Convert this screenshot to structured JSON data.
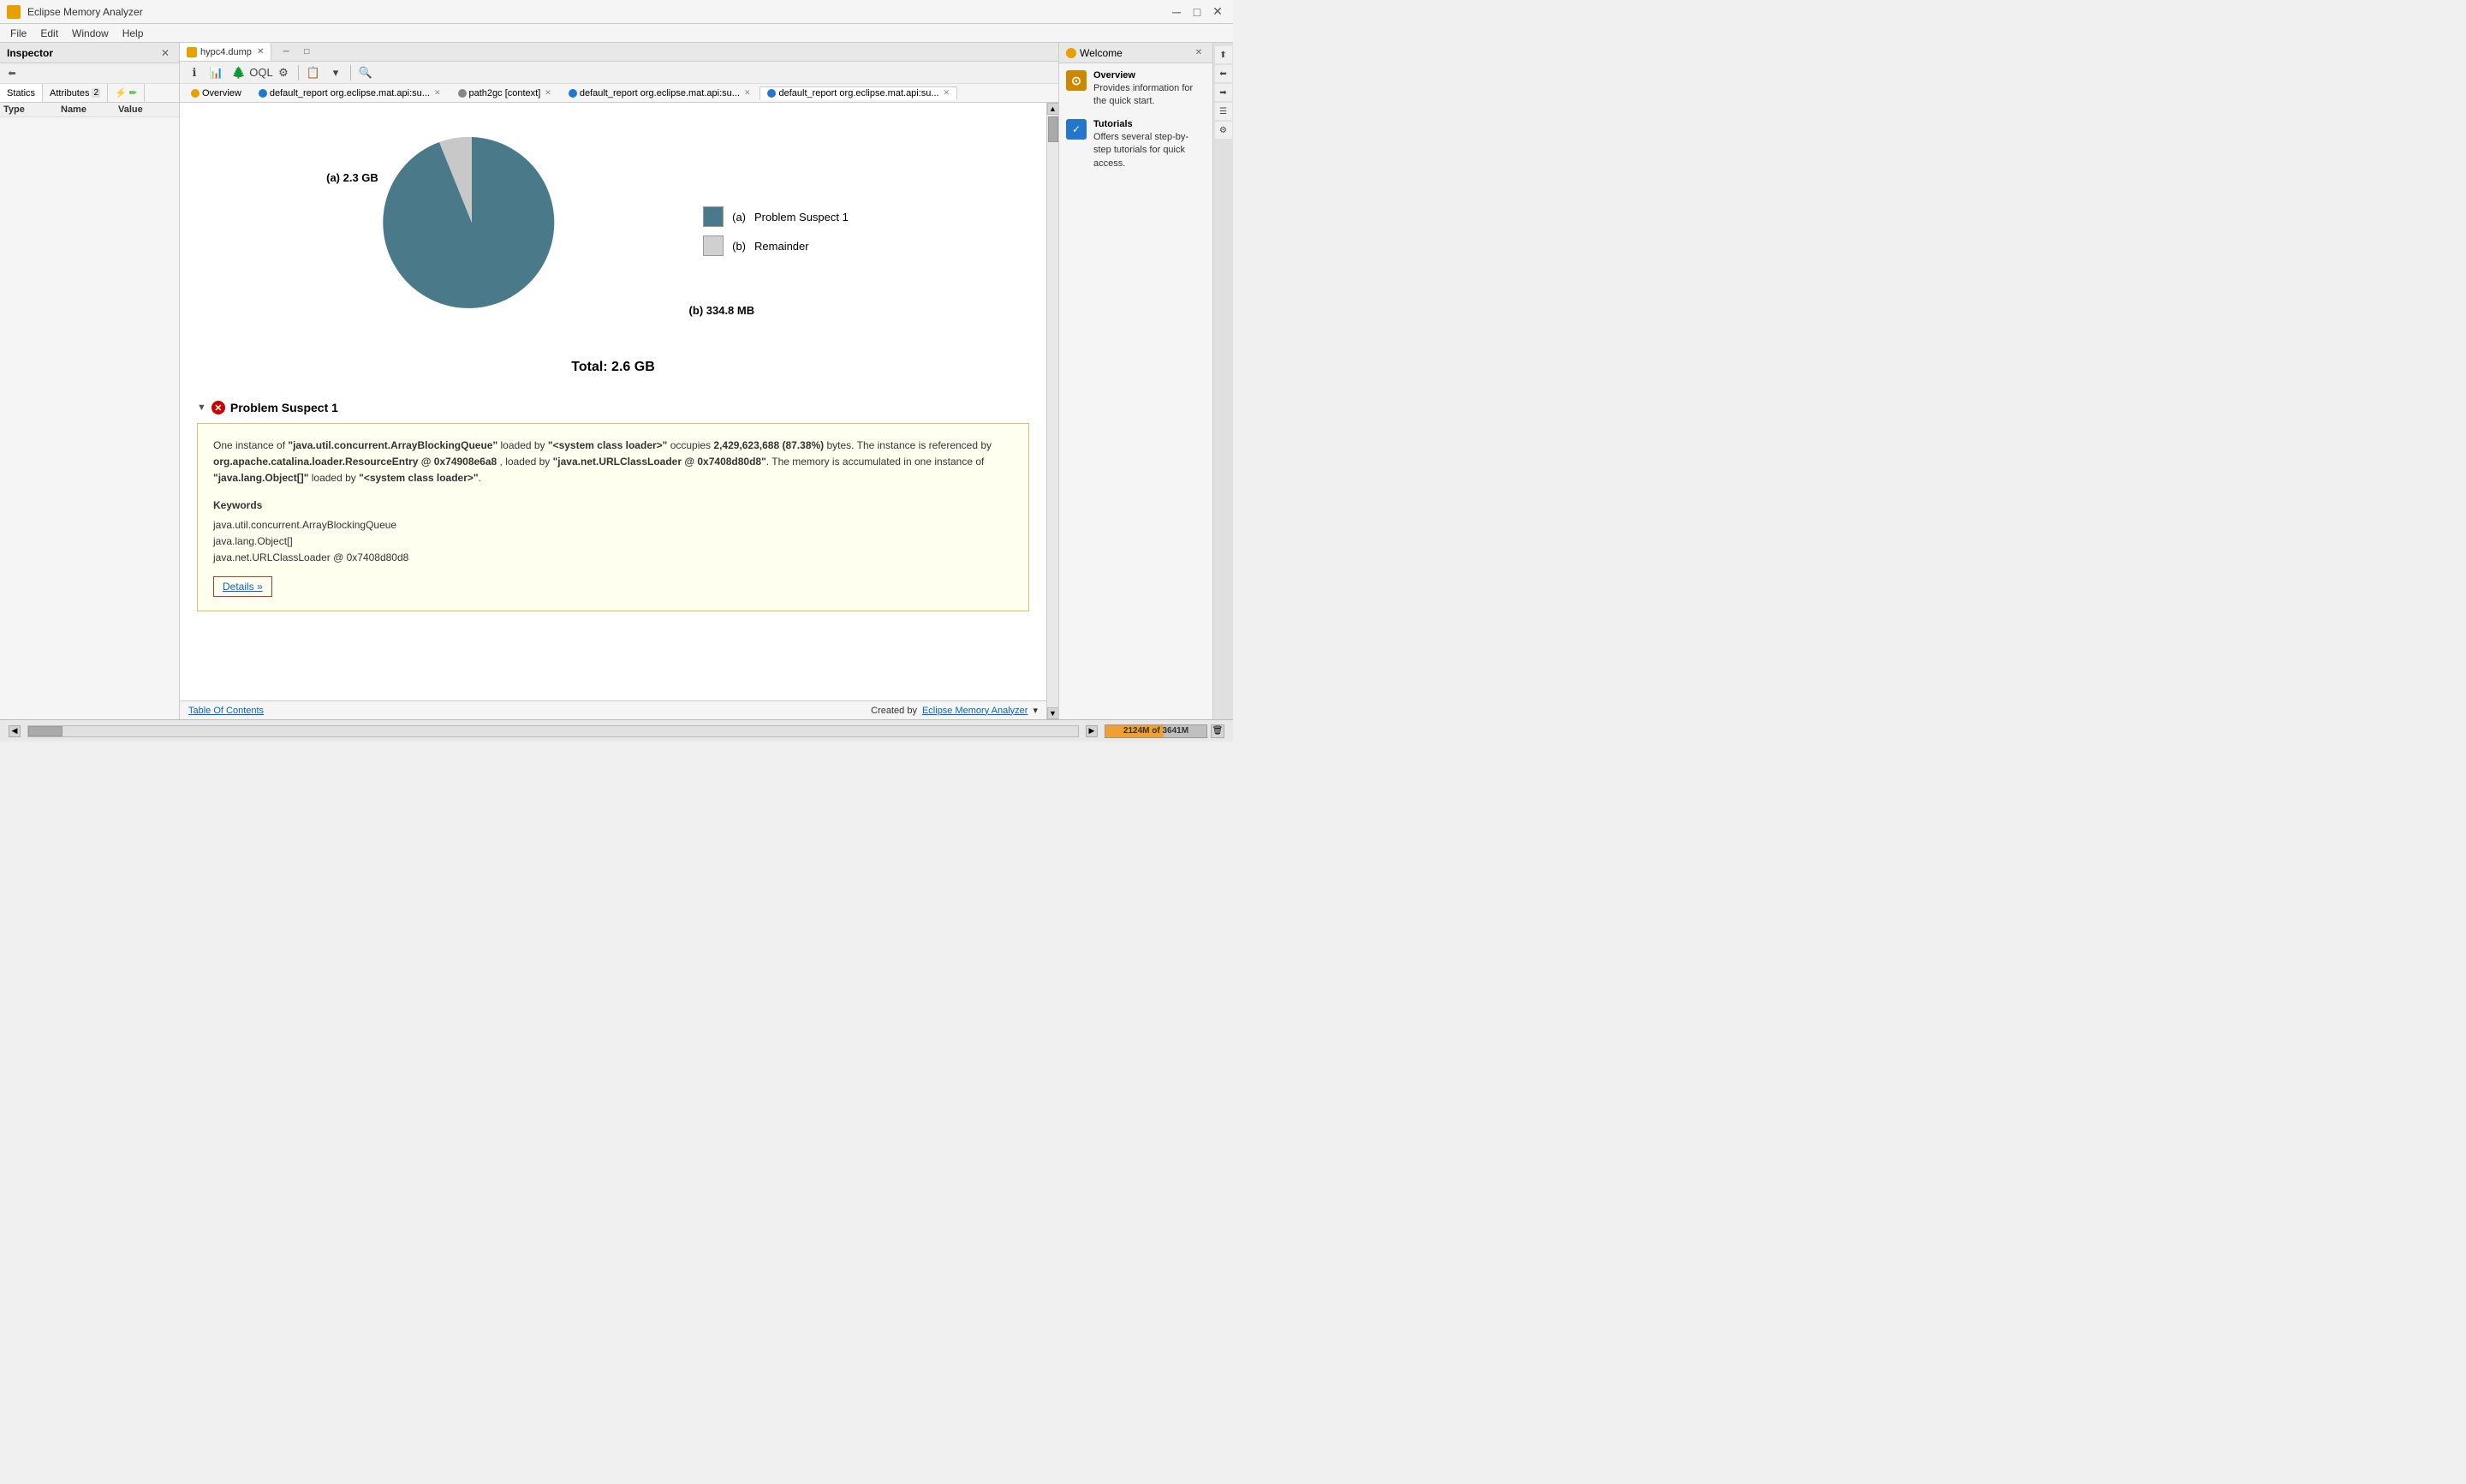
{
  "title_bar": {
    "title": "Eclipse Memory Analyzer",
    "icon": "⚙"
  },
  "menu": {
    "items": [
      "File",
      "Edit",
      "Window",
      "Help"
    ]
  },
  "left_panel": {
    "title": "Inspector",
    "close_label": "×",
    "subtabs": [
      {
        "label": "Statics",
        "active": true
      },
      {
        "label": "Attributes",
        "active": false,
        "badge": "2"
      },
      {
        "label": "⚡",
        "active": false
      }
    ],
    "columns": [
      "Type",
      "Name",
      "Value"
    ]
  },
  "tabs": [
    {
      "label": "hypc4.dump",
      "active": true,
      "closable": true
    },
    {
      "label": "Overview",
      "active": false,
      "closable": false
    }
  ],
  "subtabs": [
    {
      "label": "Overview",
      "active": false
    },
    {
      "label": "default_report org.eclipse.mat.api:su...",
      "active": false
    },
    {
      "label": "path2gc [context]",
      "active": false
    },
    {
      "label": "default_report org.eclipse.mat.api:su...",
      "active": false
    },
    {
      "label": "default_report org.eclipse.mat.api:su...",
      "active": true
    }
  ],
  "chart": {
    "label_a": "(a)  2.3 GB",
    "label_b": "(b)  334.8 MB",
    "total": "Total: 2.6 GB",
    "legend": [
      {
        "key": "(a)",
        "label": "Problem Suspect 1",
        "color": "#4a7a8a"
      },
      {
        "key": "(b)",
        "label": "Remainder",
        "color": "#d0d0d0"
      }
    ],
    "a_percent": 87.38,
    "b_percent": 12.62
  },
  "problem_suspect": {
    "title": "Problem Suspect 1",
    "description_parts": [
      {
        "text": "One instance of ",
        "bold": false
      },
      {
        "text": "\"java.util.concurrent.ArrayBlockingQueue\"",
        "bold": true
      },
      {
        "text": " loaded by ",
        "bold": false
      },
      {
        "text": "\"<system class loader>\"",
        "bold": true
      },
      {
        "text": " occupies ",
        "bold": false
      },
      {
        "text": "2,429,623,688 (87.38%)",
        "bold": true
      },
      {
        "text": " bytes. The instance is referenced by ",
        "bold": false
      },
      {
        "text": "org.apache.catalina.loader.ResourceEntry @ 0x74908e6a8",
        "bold": true
      },
      {
        "text": " , loaded by ",
        "bold": false
      },
      {
        "text": "\"java.net.URLClassLoader @ 0x7408d80d8\"",
        "bold": true
      },
      {
        "text": ". The memory is accumulated in one instance of ",
        "bold": false
      },
      {
        "text": "\"java.lang.Object[]\"",
        "bold": true
      },
      {
        "text": " loaded by ",
        "bold": false
      },
      {
        "text": "\"<system class loader>\"",
        "bold": true
      },
      {
        "text": ".",
        "bold": false
      }
    ],
    "keywords_title": "Keywords",
    "keywords": [
      "java.util.concurrent.ArrayBlockingQueue",
      "java.lang.Object[]",
      "java.net.URLClassLoader @ 0x7408d80d8"
    ],
    "details_label": "Details »"
  },
  "footer": {
    "toc_label": "Table Of Contents",
    "created_label": "Created by",
    "created_link": "Eclipse Memory Analyzer"
  },
  "right_panel": {
    "title": "Welcome",
    "close_label": "×",
    "items": [
      {
        "icon_color": "#cc8800",
        "title": "Overview",
        "description": "Provides information for the quick start."
      },
      {
        "icon_color": "#2277cc",
        "title": "Tutorials",
        "description": "Offers several step-by-step tutorials for quick access."
      }
    ]
  },
  "status_bar": {
    "memory_used": "2124M",
    "memory_total": "3641M",
    "memory_display": "2124M of 3641M"
  }
}
